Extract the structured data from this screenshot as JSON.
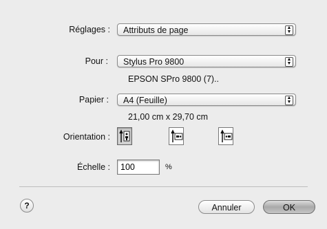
{
  "settings": {
    "label": "Réglages :",
    "value": "Attributs de page"
  },
  "format_for": {
    "label": "Pour :",
    "value": "Stylus Pro 9800",
    "detail": "EPSON SPro 9800 (7).."
  },
  "paper": {
    "label": "Papier :",
    "value": "A4 (Feuille)",
    "dimensions": "21,00 cm x 29,70 cm"
  },
  "orientation": {
    "label": "Orientation :",
    "options": [
      "portrait",
      "landscape",
      "landscape-reversed"
    ],
    "selected": "portrait"
  },
  "scale": {
    "label": "Échelle :",
    "value": "100",
    "unit": "%"
  },
  "buttons": {
    "help": "?",
    "cancel": "Annuler",
    "ok": "OK"
  },
  "popup_arrows": "⬍"
}
